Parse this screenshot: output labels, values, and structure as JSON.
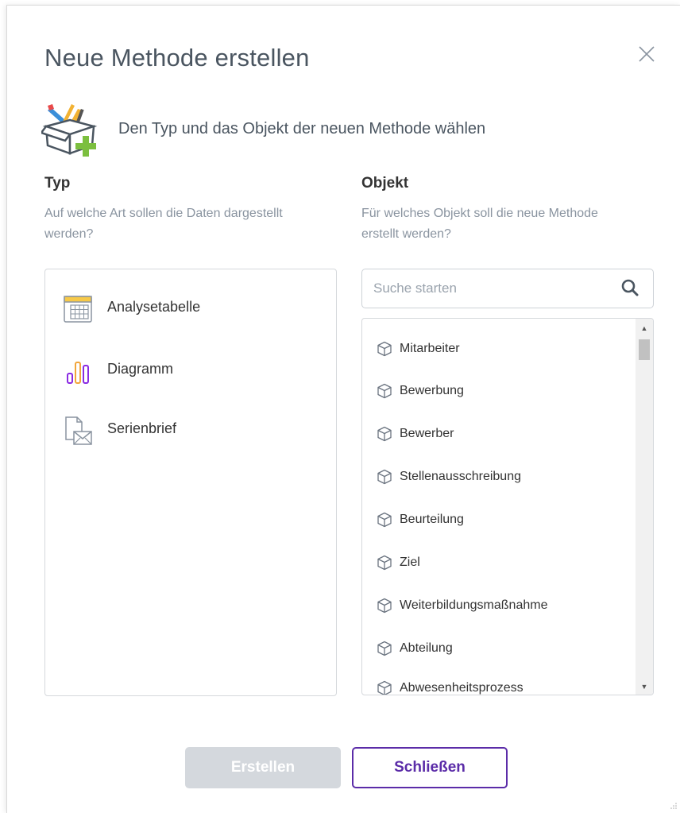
{
  "dialog": {
    "title": "Neue Methode erstellen",
    "subtitle": "Den Typ und das Objekt der neuen Methode wählen",
    "close_icon": "close-icon",
    "hero_icon": "toolbox-add-icon"
  },
  "type_column": {
    "heading": "Typ",
    "description": "Auf welche Art sollen die Daten dargestellt werden?",
    "items": [
      {
        "label": "Analysetabelle",
        "icon": "table-icon"
      },
      {
        "label": "Diagramm",
        "icon": "bar-chart-icon"
      },
      {
        "label": "Serienbrief",
        "icon": "mail-document-icon"
      }
    ]
  },
  "object_column": {
    "heading": "Objekt",
    "description": "Für welches Objekt soll die neue Methode erstellt werden?",
    "search": {
      "placeholder": "Suche starten",
      "value": ""
    },
    "items": [
      {
        "label": "Mitarbeiter"
      },
      {
        "label": "Bewerbung"
      },
      {
        "label": "Bewerber"
      },
      {
        "label": "Stellenausschreibung"
      },
      {
        "label": "Beurteilung"
      },
      {
        "label": "Ziel"
      },
      {
        "label": "Weiterbildungsmaßnahme"
      },
      {
        "label": "Abteilung"
      },
      {
        "label": "Abwesenheitsprozess"
      }
    ]
  },
  "footer": {
    "create_label": "Erstellen",
    "close_label": "Schließen"
  },
  "colors": {
    "accent": "#5b2ca8",
    "disabled_button": "#d4d8dd",
    "muted_text": "#8a94a0"
  }
}
